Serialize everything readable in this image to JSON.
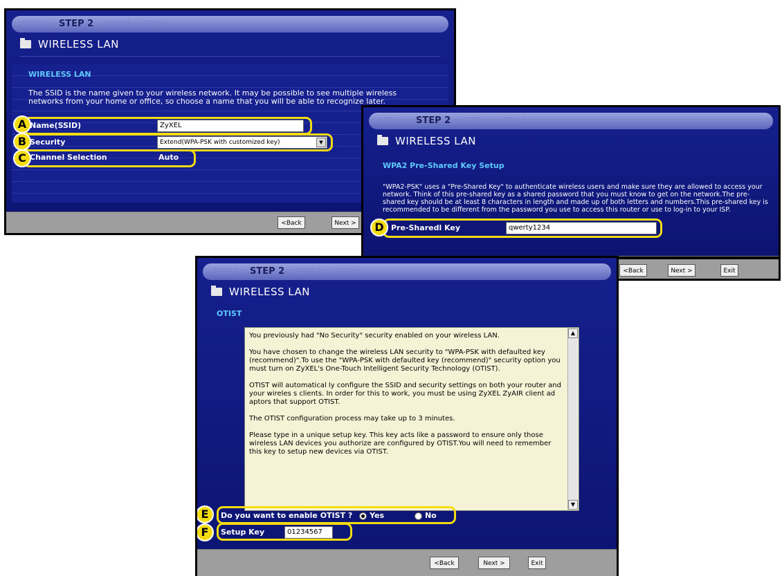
{
  "steps": {
    "step1": "STEP 1",
    "step2": "STEP 2",
    "step3": "STEP 3",
    "step4": "STEP 4",
    "sep": ">"
  },
  "page_title": "WIRELESS LAN",
  "panel1": {
    "section": "WIRELESS LAN",
    "description": "The SSID is the name given to your wireless network. It may be possible to see multiple wireless networks from your home or office, so choose a name that you will be able to recognize later.",
    "name_label": "Name(SSID)",
    "name_value": "ZyXEL",
    "security_label": "Security",
    "security_value": "Extend(WPA-PSK with customized key)",
    "channel_label": "Channel Selection",
    "channel_value": "Auto",
    "back": "<Back",
    "next": "Next >"
  },
  "panel2": {
    "section": "WPA2 Pre-Shared Key Setup",
    "description": "\"WPA2-PSK\" uses a \"Pre-Shared Key\" to authenticate wireless users and make sure they are allowed to access your network. Think of this pre-shared key as a shared password that you must know to get on the network.The pre-shared key should be at least 8 characters in length and made up of both letters and numbers.This pre-shared key is recommended to be different from the password you use to access this router or use to log-in to your ISP.",
    "psk_label": "Pre-Sharedl Key",
    "psk_value": "qwerty1234",
    "back": "<Back",
    "next": "Next >",
    "exit": "Exit"
  },
  "panel3": {
    "section": "OTIST",
    "memo": [
      "You previously had \"No Security\" security enabled on your wireless LAN.",
      "You have chosen to change the wireless LAN security to \"WPA-PSK with defaulted key (recommend)\".To use the \"WPA-PSK with defaulted key (recommend)\" security option you must turn on ZyXEL's One-Touch Intelligent Security Technology (OTIST).",
      "OTIST will automatical ly configure the SSID and security settings on both your router and your wireles s clients. In order for this to work, you must be using ZyXEL ZyAIR client ad aptors that support OTIST.",
      "The OTIST configuration process may take up to 3 minutes.",
      "Please type in a unique setup key. This key acts like a password to ensure only those wireless LAN devices you authorize are configured by OTIST.You will need to remember this key to setup new devices via OTIST."
    ],
    "enable_label": "Do you want to enable OTIST ?",
    "yes": "Yes",
    "no": "No",
    "setup_key_label": "Setup Key",
    "setup_key_value": "01234567",
    "back": "<Back",
    "next": "Next >",
    "exit": "Exit"
  },
  "callouts": {
    "a": "A",
    "b": "B",
    "c": "C",
    "d": "D",
    "e": "E",
    "f": "F"
  },
  "colors": {
    "panel_bg": "#16208e",
    "highlight": "#f4dc12",
    "section_head": "#5fc9ff",
    "memo_bg": "#f5f3d6"
  }
}
